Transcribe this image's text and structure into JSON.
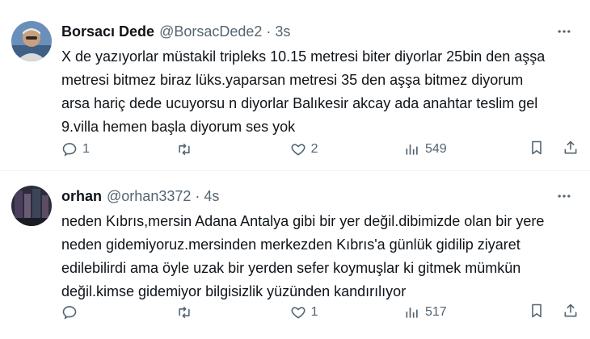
{
  "tweets": [
    {
      "name": "Borsacı Dede",
      "handle": "@BorsacDede2",
      "dot": "·",
      "time": "3s",
      "text_lines": [
        "X de yazıyorlar müstakil tripleks 10.15 metresi biter diyorlar 25bin den aşşa",
        "metresi bitmez biraz lüks.yaparsan metresi 35 den aşşa bitmez diyorum",
        "arsa hariç dede ucuyorsu n diyorlar Balıkesir akcay ada anahtar teslim gel",
        "9.villa hemen başla diyorum ses yok"
      ],
      "replies": "1",
      "retweets": "",
      "likes": "2",
      "views": "549"
    },
    {
      "name": "orhan",
      "handle": "@orhan3372",
      "dot": "·",
      "time": "4s",
      "text_lines": [
        "neden Kıbrıs,mersin Adana Antalya gibi bir yer değil.dibimizde olan bir yere",
        "neden gidemiyoruz.mersinden merkezden Kıbrıs'a günlük gidilip ziyaret",
        "edilebilirdi ama öyle uzak bir yerden sefer koymuşlar ki gitmek mümkün",
        "değil.kimse gidemiyor bilgisizlik yüzünden kandırılıyor"
      ],
      "replies": "",
      "retweets": "",
      "likes": "1",
      "views": "517"
    }
  ],
  "colors": {
    "text": "#0f1419",
    "secondary": "#536471",
    "border": "#eff3f4"
  }
}
